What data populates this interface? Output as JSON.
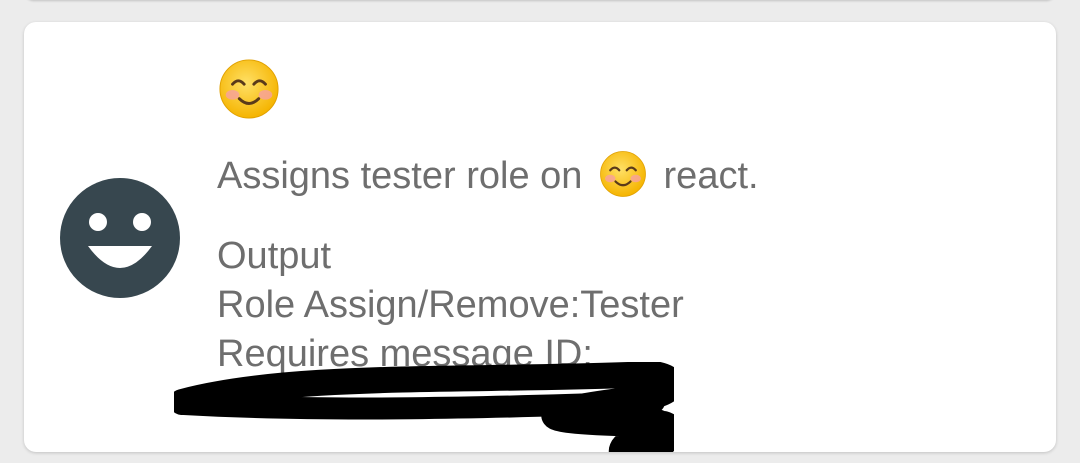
{
  "command": {
    "emoji_icon": "smiling-face-with-smiling-eyes",
    "description_before": "Assigns tester role on",
    "description_after": "react.",
    "output_label": "Output",
    "output_role_line": "Role Assign/Remove:Tester",
    "output_requires_line": "Requires message ID:"
  },
  "colors": {
    "avatar": "#37474f",
    "text": "#6e6e6e",
    "card": "#ffffff",
    "background": "#ececec",
    "emoji_face": "#fbc02d"
  }
}
